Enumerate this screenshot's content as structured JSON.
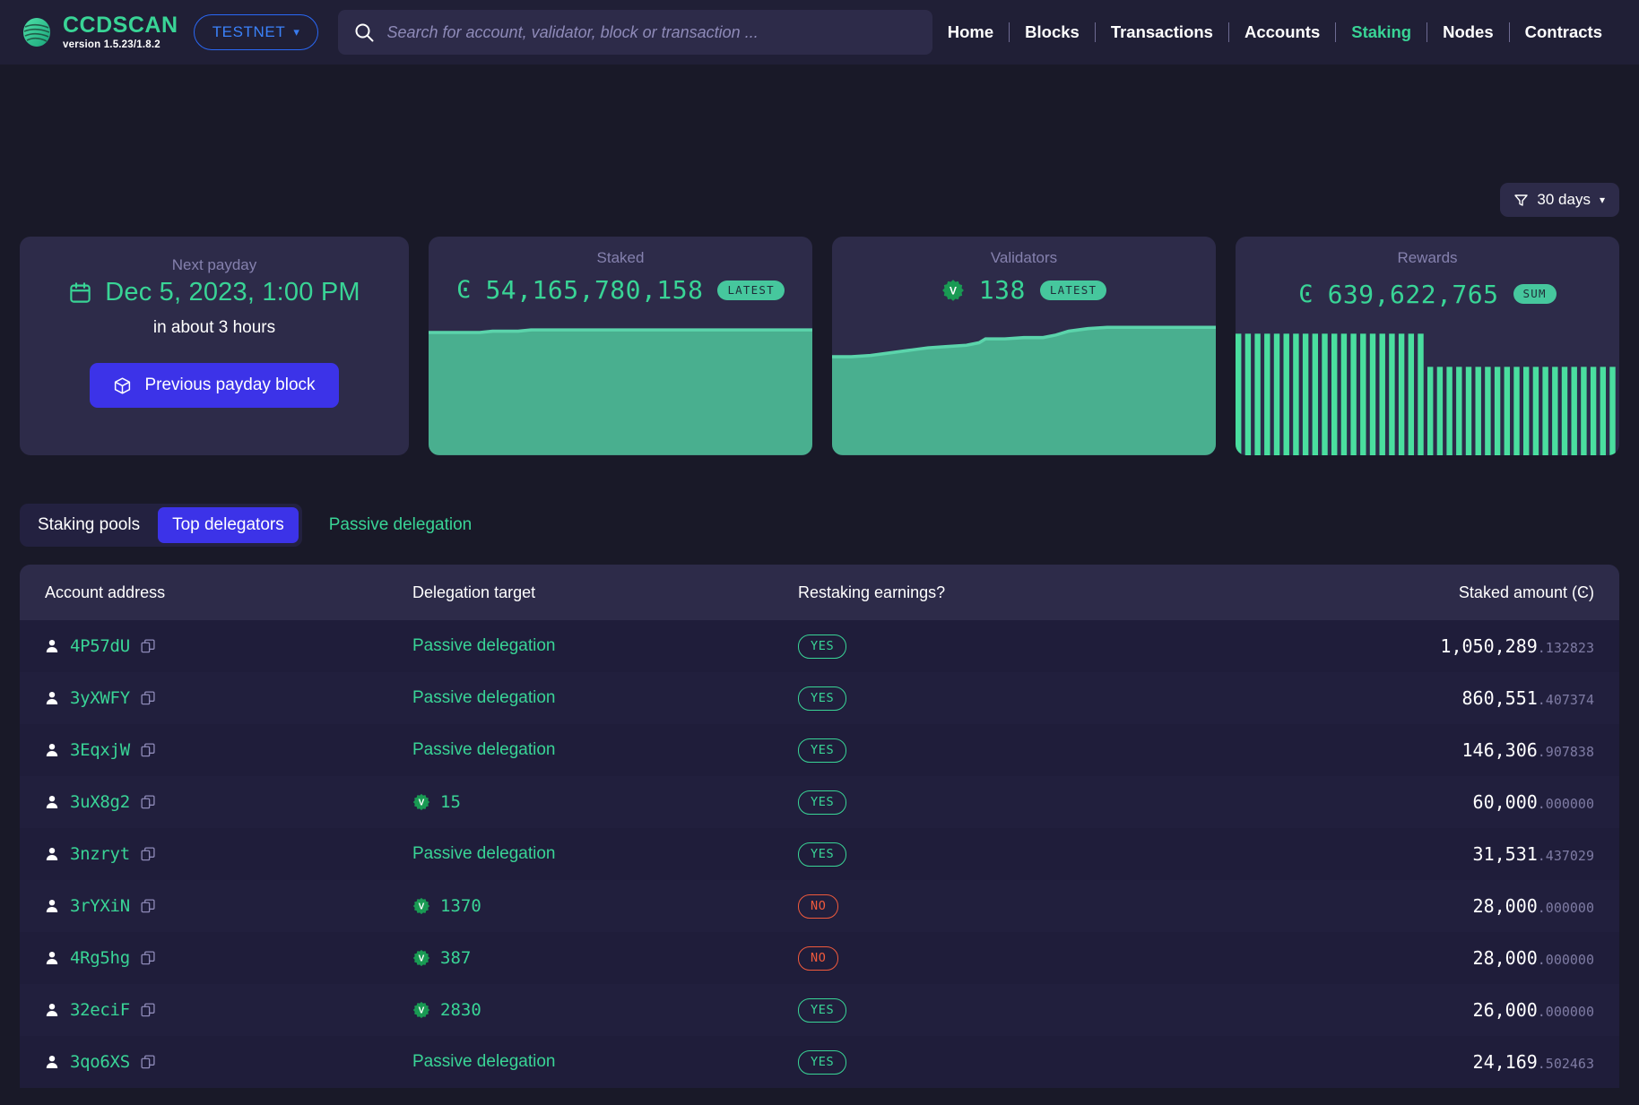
{
  "header": {
    "brand_name": "CCDSCAN",
    "brand_version": "version 1.5.23/1.8.2",
    "network_label": "TESTNET",
    "search_placeholder": "Search for account, validator, block or transaction ...",
    "search_value": "",
    "nav": [
      {
        "label": "Home",
        "active": false
      },
      {
        "label": "Blocks",
        "active": false
      },
      {
        "label": "Transactions",
        "active": false
      },
      {
        "label": "Accounts",
        "active": false
      },
      {
        "label": "Staking",
        "active": true
      },
      {
        "label": "Nodes",
        "active": false
      },
      {
        "label": "Contracts",
        "active": false
      }
    ]
  },
  "filter": {
    "label": "30 days"
  },
  "cards": {
    "payday": {
      "label": "Next payday",
      "date": "Dec 5, 2023, 1:00 PM",
      "relative": "in about 3 hours",
      "button_label": "Previous payday block"
    },
    "staked": {
      "label": "Staked",
      "symbol": "Ͼ",
      "value": "54,165,780,158",
      "badge": "LATEST"
    },
    "validators": {
      "label": "Validators",
      "value": "138",
      "badge": "LATEST"
    },
    "rewards": {
      "label": "Rewards",
      "symbol": "Ͼ",
      "value": "639,622,765",
      "badge": "SUM"
    }
  },
  "tabs": {
    "items": [
      {
        "label": "Staking pools",
        "active": false
      },
      {
        "label": "Top delegators",
        "active": true
      }
    ],
    "link": "Passive delegation"
  },
  "table": {
    "columns": [
      "Account address",
      "Delegation target",
      "Restaking earnings?",
      "Staked amount (Ͼ)"
    ],
    "rows": [
      {
        "address": "4P57dU",
        "target": "Passive delegation",
        "target_type": "passive",
        "restaking": "YES",
        "amount_int": "1,050,289",
        "amount_dec": ".132823"
      },
      {
        "address": "3yXWFY",
        "target": "Passive delegation",
        "target_type": "passive",
        "restaking": "YES",
        "amount_int": "860,551",
        "amount_dec": ".407374"
      },
      {
        "address": "3EqxjW",
        "target": "Passive delegation",
        "target_type": "passive",
        "restaking": "YES",
        "amount_int": "146,306",
        "amount_dec": ".907838"
      },
      {
        "address": "3uX8g2",
        "target": "15",
        "target_type": "validator",
        "restaking": "YES",
        "amount_int": "60,000",
        "amount_dec": ".000000"
      },
      {
        "address": "3nzryt",
        "target": "Passive delegation",
        "target_type": "passive",
        "restaking": "YES",
        "amount_int": "31,531",
        "amount_dec": ".437029"
      },
      {
        "address": "3rYXiN",
        "target": "1370",
        "target_type": "validator",
        "restaking": "NO",
        "amount_int": "28,000",
        "amount_dec": ".000000"
      },
      {
        "address": "4Rg5hg",
        "target": "387",
        "target_type": "validator",
        "restaking": "NO",
        "amount_int": "28,000",
        "amount_dec": ".000000"
      },
      {
        "address": "32eciF",
        "target": "2830",
        "target_type": "validator",
        "restaking": "YES",
        "amount_int": "26,000",
        "amount_dec": ".000000"
      },
      {
        "address": "3qo6XS",
        "target": "Passive delegation",
        "target_type": "passive",
        "restaking": "YES",
        "amount_int": "24,169",
        "amount_dec": ".502463"
      }
    ]
  },
  "chart_data": [
    {
      "type": "area",
      "title": "Staked",
      "series": [
        {
          "name": "Staked",
          "values": [
            88,
            88,
            88,
            88,
            88,
            88.5,
            88.5,
            88.5,
            89,
            89,
            89,
            89,
            89,
            89,
            89,
            89,
            89,
            89,
            89,
            89,
            89,
            89,
            89,
            89,
            89,
            89,
            89,
            89,
            89,
            89
          ]
        }
      ],
      "ylabel": "",
      "xlabel": "",
      "grid": false,
      "legend": "none"
    },
    {
      "type": "area",
      "title": "Validators",
      "series": [
        {
          "name": "Validators",
          "values": [
            70,
            70,
            70,
            71,
            72,
            73,
            74,
            75,
            76,
            77,
            78,
            78,
            79,
            79,
            80,
            82,
            82,
            83,
            84,
            86,
            89,
            91,
            92,
            92,
            92,
            92,
            92,
            92,
            92,
            92
          ]
        }
      ],
      "ylabel": "",
      "xlabel": "",
      "grid": false,
      "legend": "none"
    },
    {
      "type": "bar",
      "title": "Rewards",
      "categories": [
        "1",
        "2",
        "3",
        "4",
        "5",
        "6",
        "7",
        "8",
        "9",
        "10",
        "11",
        "12",
        "13",
        "14",
        "15",
        "16",
        "17",
        "18",
        "19",
        "20",
        "21",
        "22",
        "23",
        "24",
        "25",
        "26",
        "27",
        "28",
        "29",
        "30",
        "31",
        "32",
        "33",
        "34",
        "35",
        "36",
        "37",
        "38",
        "39",
        "40"
      ],
      "values": [
        96,
        96,
        96,
        96,
        96,
        96,
        96,
        96,
        96,
        96,
        96,
        96,
        96,
        96,
        96,
        96,
        96,
        96,
        96,
        96,
        64,
        64,
        64,
        64,
        64,
        64,
        64,
        64,
        64,
        64,
        64,
        64,
        64,
        64,
        64,
        64,
        64,
        64,
        64,
        64
      ],
      "ylabel": "",
      "xlabel": "",
      "grid": false,
      "legend": "none"
    }
  ]
}
